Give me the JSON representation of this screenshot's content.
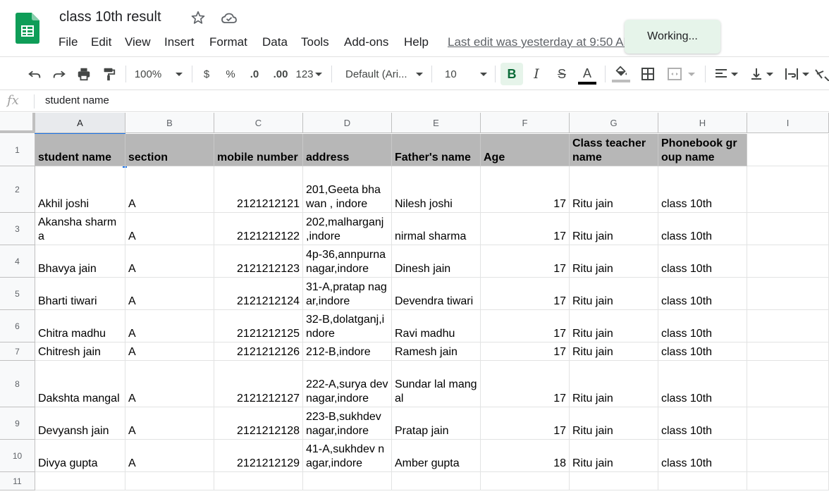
{
  "header": {
    "doc_title": "class 10th result",
    "menu": [
      "File",
      "Edit",
      "View",
      "Insert",
      "Format",
      "Data",
      "Tools",
      "Add-ons",
      "Help"
    ],
    "last_edit": "Last edit was yesterday at 9:50 AM",
    "toast": "Working..."
  },
  "toolbar": {
    "zoom": "100%",
    "currency": "$",
    "percent": "%",
    "decrease_decimal": ".0",
    "increase_decimal": ".00",
    "more_formats": "123",
    "font": "Default (Ari...",
    "font_size": "10",
    "bold": "B",
    "italic": "I",
    "strike": "S",
    "text_color": "A"
  },
  "formula_bar": {
    "fx": "fx",
    "content": "student name"
  },
  "grid": {
    "columns": [
      "A",
      "B",
      "C",
      "D",
      "E",
      "F",
      "G",
      "H",
      "I"
    ],
    "selected_column": "A",
    "rows": [
      "1",
      "2",
      "3",
      "4",
      "5",
      "6",
      "7",
      "8",
      "9",
      "10",
      "11"
    ],
    "header_row": [
      "student name",
      "section",
      "mobile number",
      "address",
      "Father's name",
      "Age",
      "Class teacher name",
      "Phonebook group name"
    ],
    "data": [
      [
        "Akhil joshi",
        "A",
        "2121212121",
        "201,Geeta bhawan , indore",
        "Nilesh joshi",
        "17",
        "Ritu jain",
        "class 10th"
      ],
      [
        "Akansha sharma",
        "A",
        "2121212122",
        "202,malharganj ,indore",
        "nirmal sharma",
        "17",
        "Ritu jain",
        "class 10th"
      ],
      [
        "Bhavya jain",
        "A",
        "2121212123",
        "4p-36,annpurna nagar,indore",
        "Dinesh jain",
        "17",
        "Ritu jain",
        "class 10th"
      ],
      [
        "Bharti tiwari",
        "A",
        "2121212124",
        "31-A,pratap nagar,indore",
        "Devendra tiwari",
        "17",
        "Ritu jain",
        "class 10th"
      ],
      [
        "Chitra madhu",
        "A",
        "2121212125",
        "32-B,dolatganj,indore",
        "Ravi madhu",
        "17",
        "Ritu jain",
        "class 10th"
      ],
      [
        "Chitresh jain",
        "A",
        "2121212126",
        "212-B,indore",
        "Ramesh jain",
        "17",
        "Ritu jain",
        "class 10th"
      ],
      [
        "Dakshta mangal",
        "A",
        "2121212127",
        "222-A,surya dev nagar,indore",
        "Sundar lal mangal",
        "17",
        "Ritu jain",
        "class 10th"
      ],
      [
        "Devyansh jain",
        "A",
        "2121212128",
        "223-B,sukhdev nagar,indore",
        "Pratap jain",
        "17",
        "Ritu jain",
        "class 10th"
      ],
      [
        "Divya gupta",
        "A",
        "2121212129",
        "41-A,sukhdev nagar,indore",
        "Amber gupta",
        "18",
        "Ritu jain",
        "class 10th"
      ]
    ]
  },
  "colors": {
    "header_fill": "#b7b7b7",
    "selection": "#1a73e8",
    "toast_bg": "#e6f4ea",
    "sheets_green": "#0f9d58"
  }
}
